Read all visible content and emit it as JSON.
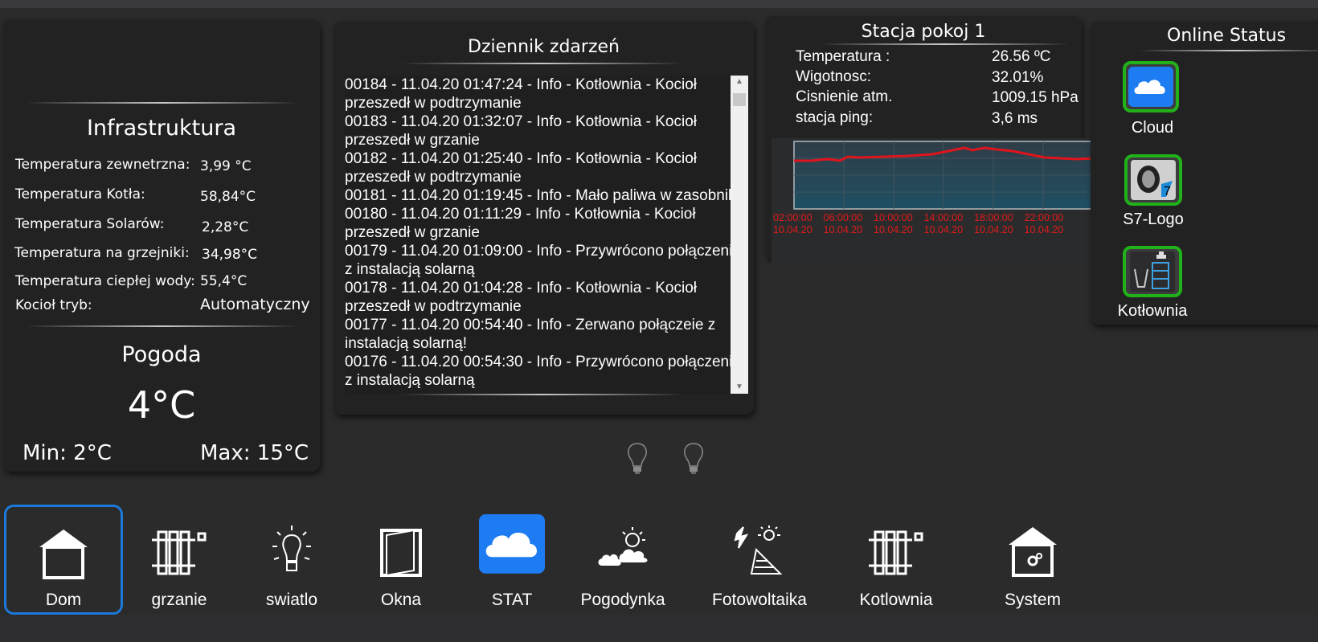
{
  "infrastruktura": {
    "title": "Infrastruktura",
    "rows": [
      {
        "label": "Temperatura zewnetrzna:",
        "value": "3,99 °C"
      },
      {
        "label": "Temperatura Kotła:",
        "value": "58,84°C"
      },
      {
        "label": "Temperatura Solarów:",
        "value": "2,28°C"
      },
      {
        "label": "Temperatura na grzejniki:",
        "value": "34,98°C"
      },
      {
        "label": "Temperatura ciepłej wody:",
        "value": "55,4°C"
      },
      {
        "label": "Kocioł tryb:",
        "value": "Automatyczny"
      }
    ]
  },
  "pogoda": {
    "title": "Pogoda",
    "temp": "4°C",
    "min": "Min: 2°C",
    "max": "Max: 15°C"
  },
  "dziennik": {
    "title": "Dziennik zdarzeń",
    "entries": [
      "00184 - 11.04.20 01:47:24 - Info - Kotłownia - Kocioł przeszedł w podtrzymanie",
      "00183 - 11.04.20 01:32:07 - Info - Kotłownia - Kocioł przeszedł w grzanie",
      "00182 - 11.04.20 01:25:40 - Info - Kotłownia - Kocioł przeszedł w podtrzymanie",
      "00181 - 11.04.20 01:19:45 - Info - Mało paliwa w zasobniku",
      "00180 - 11.04.20 01:11:29 - Info - Kotłownia - Kocioł przeszedł w grzanie",
      "00179 - 11.04.20 01:09:00 - Info - Przywrócono połączenie z instalacją solarną",
      "00178 - 11.04.20 01:04:28 - Info - Kotłownia - Kocioł przeszedł w podtrzymanie",
      "00177 - 11.04.20 00:54:40 - Info - Zerwano połączeie z instalacją solarną!",
      "00176 - 11.04.20 00:54:30 - Info - Przywrócono połączenie z instalacją solarną"
    ]
  },
  "stacja": {
    "title": "Stacja pokoj 1",
    "rows": [
      {
        "label": "Temperatura :",
        "value": "26.56 ºC"
      },
      {
        "label": "Wigotnosc:",
        "value": "32.01%"
      },
      {
        "label": "Cisnienie atm.",
        "value": "1009.15 hPa"
      },
      {
        "label": "stacja ping:",
        "value": "3,6 ms"
      }
    ],
    "ticks": [
      {
        "time": "02:00:00",
        "date": "10.04.20"
      },
      {
        "time": "06:00:00",
        "date": "10.04.20"
      },
      {
        "time": "10:00:00",
        "date": "10.04.20"
      },
      {
        "time": "14:00:00",
        "date": "10.04.20"
      },
      {
        "time": "18:00:00",
        "date": "10.04.20"
      },
      {
        "time": "22:00:00",
        "date": "10.04.20"
      }
    ],
    "line_color": "#e0141c"
  },
  "online": {
    "title": "Online Status",
    "items": [
      {
        "label": "Cloud",
        "icon": "cloud-icon"
      },
      {
        "label": "S7-Logo",
        "icon": "s7-logo-icon"
      },
      {
        "label": "Kotłownia",
        "icon": "boiler-room-icon"
      }
    ],
    "ok_color": "#21b21a"
  },
  "nav": {
    "items": [
      {
        "label": "Dom",
        "icon": "house-icon",
        "active": true
      },
      {
        "label": "grzanie",
        "icon": "radiator-icon"
      },
      {
        "label": "swiatlo",
        "icon": "bulb-icon"
      },
      {
        "label": "Okna",
        "icon": "window-icon"
      },
      {
        "label": "STAT",
        "icon": "cloud-icon"
      },
      {
        "label": "Pogodynka",
        "icon": "weather-icon"
      },
      {
        "label": "Fotowoltaika",
        "icon": "solar-panel-icon"
      },
      {
        "label": "Kotlownia",
        "icon": "radiator-icon"
      },
      {
        "label": "System",
        "icon": "house-gear-icon"
      }
    ],
    "active_color": "#1c78d9",
    "stat_bg": "#1e7cf2"
  }
}
